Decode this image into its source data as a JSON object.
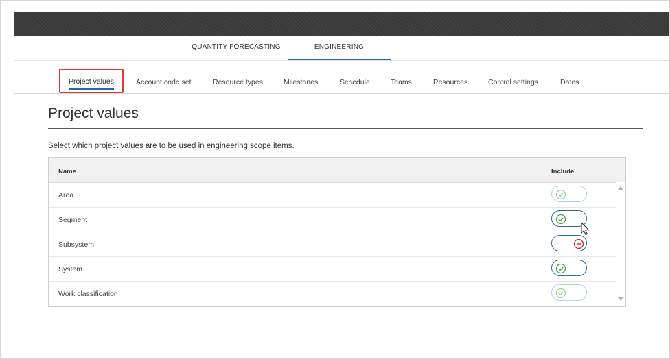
{
  "main_tabs": [
    {
      "label": "QUANTITY FORECASTING",
      "active": false
    },
    {
      "label": "ENGINEERING",
      "active": true
    }
  ],
  "sub_tabs": [
    {
      "label": "Project values",
      "active": true
    },
    {
      "label": "Account code set"
    },
    {
      "label": "Resource types"
    },
    {
      "label": "Milestones"
    },
    {
      "label": "Schedule"
    },
    {
      "label": "Teams"
    },
    {
      "label": "Resources"
    },
    {
      "label": "Control settings"
    },
    {
      "label": "Dates"
    }
  ],
  "page": {
    "title": "Project values",
    "description": "Select which project values are to be used in engineering scope items."
  },
  "grid": {
    "columns": {
      "name": "Name",
      "include": "Include"
    },
    "rows": [
      {
        "name": "Area",
        "include": true
      },
      {
        "name": "Segment",
        "include": true
      },
      {
        "name": "Subsystem",
        "include": false
      },
      {
        "name": "System",
        "include": true
      },
      {
        "name": "Work classification",
        "include": true
      }
    ]
  },
  "colors": {
    "accent": "#1f6fa3",
    "highlight_box": "#e53935",
    "check_green": "#43a047",
    "exclude_red": "#c62828",
    "topbar": "#3a3a3a"
  },
  "icons": {
    "include_on": "check-circle-icon",
    "include_off": "minus-circle-icon"
  }
}
